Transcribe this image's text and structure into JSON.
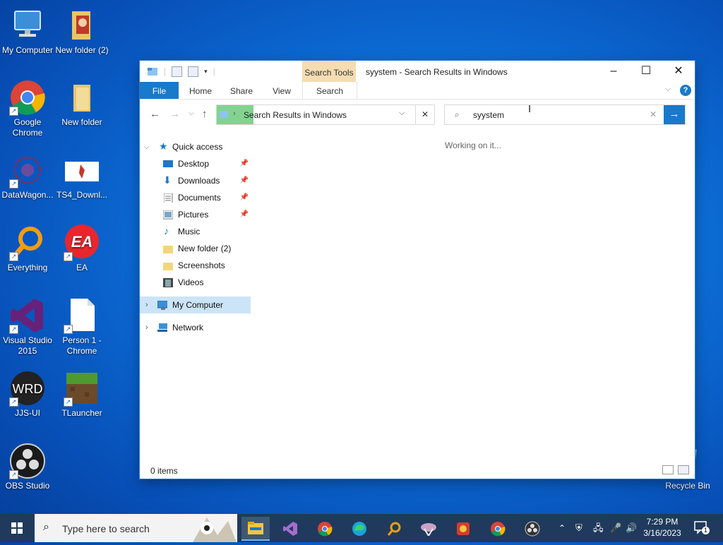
{
  "desktop": {
    "icons": [
      {
        "label": "My Computer",
        "icon": "computer-icon"
      },
      {
        "label": "New folder (2)",
        "icon": "folder-icon"
      },
      {
        "label": "Google Chrome",
        "icon": "chrome-icon"
      },
      {
        "label": "New folder",
        "icon": "folder-icon"
      },
      {
        "label": "DataWagon...",
        "icon": "datawagon-icon"
      },
      {
        "label": "TS4_Downl...",
        "icon": "image-file-icon"
      },
      {
        "label": "Everything",
        "icon": "everything-icon"
      },
      {
        "label": "EA",
        "icon": "ea-icon"
      },
      {
        "label": "Visual Studio 2015",
        "icon": "visual-studio-icon"
      },
      {
        "label": "Person 1 - Chrome",
        "icon": "file-icon"
      },
      {
        "label": "JJS-UI",
        "icon": "wrd-icon"
      },
      {
        "label": "TLauncher",
        "icon": "tlauncher-icon"
      },
      {
        "label": "OBS Studio",
        "icon": "obs-icon"
      },
      {
        "label": "Recycle Bin",
        "icon": "recycle-bin-icon"
      }
    ],
    "ea_logo_text": "EA",
    "wrd_logo_text": "WRD"
  },
  "explorer": {
    "title": "syystem - Search Results in Windows",
    "context_tab": "Search Tools",
    "ribbon_tabs": [
      "File",
      "Home",
      "Share",
      "View",
      "Search"
    ],
    "address": "Search Results in Windows",
    "search_value": "syystem",
    "working_text": "Working on it...",
    "nav": {
      "quick_access": "Quick access",
      "items": [
        "Desktop",
        "Downloads",
        "Documents",
        "Pictures",
        "Music",
        "New folder (2)",
        "Screenshots",
        "Videos"
      ],
      "my_computer": "My Computer",
      "network": "Network"
    },
    "status": "0 items"
  },
  "taskbar": {
    "search_placeholder": "Type here to search",
    "time": "7:29 PM",
    "date": "3/16/2023",
    "notification_count": "1"
  },
  "colors": {
    "accent": "#1979ca",
    "context_tab": "#f6dcb2",
    "selected_nav": "#cce4f7"
  }
}
